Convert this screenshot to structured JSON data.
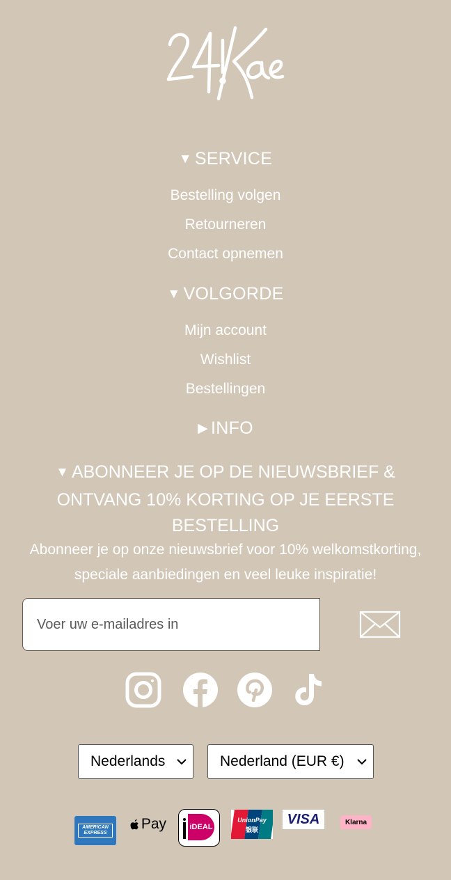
{
  "brand": {
    "logo_text": "24Kae"
  },
  "sections": {
    "service": {
      "arrow": "▼",
      "title": "SERVICE",
      "links": [
        "Bestelling volgen",
        "Retourneren",
        "Contact opnemen"
      ]
    },
    "volgorde": {
      "arrow": "▼",
      "title": "VOLGORDE",
      "links": [
        "Mijn account",
        "Wishlist",
        "Bestellingen"
      ]
    },
    "info": {
      "arrow": "▶",
      "title": "INFO"
    }
  },
  "newsletter": {
    "arrow": "▼",
    "title": "ABONNEER JE OP DE NIEUWSBRIEF & ONTVANG 10% KORTING OP JE EERSTE BESTELLING",
    "text": "Abonneer je op onze nieuwsbrief voor 10% welkomstkorting, speciale aanbiedingen en veel leuke inspiratie!",
    "placeholder": "Voer uw e-mailadres in",
    "send_icon": "envelope-icon"
  },
  "social": [
    "instagram-icon",
    "facebook-icon",
    "pinterest-icon",
    "tiktok-icon"
  ],
  "selectors": {
    "language": "Nederlands",
    "country": "Nederland (EUR €)"
  },
  "payments": {
    "amex": "AMERICAN EXPRESS",
    "applepay": "Pay",
    "ideal": "iDEAL",
    "unionpay": "UnionPay",
    "unionpay_cn": "银联",
    "visa": "VISA",
    "klarna": "Klarna"
  }
}
